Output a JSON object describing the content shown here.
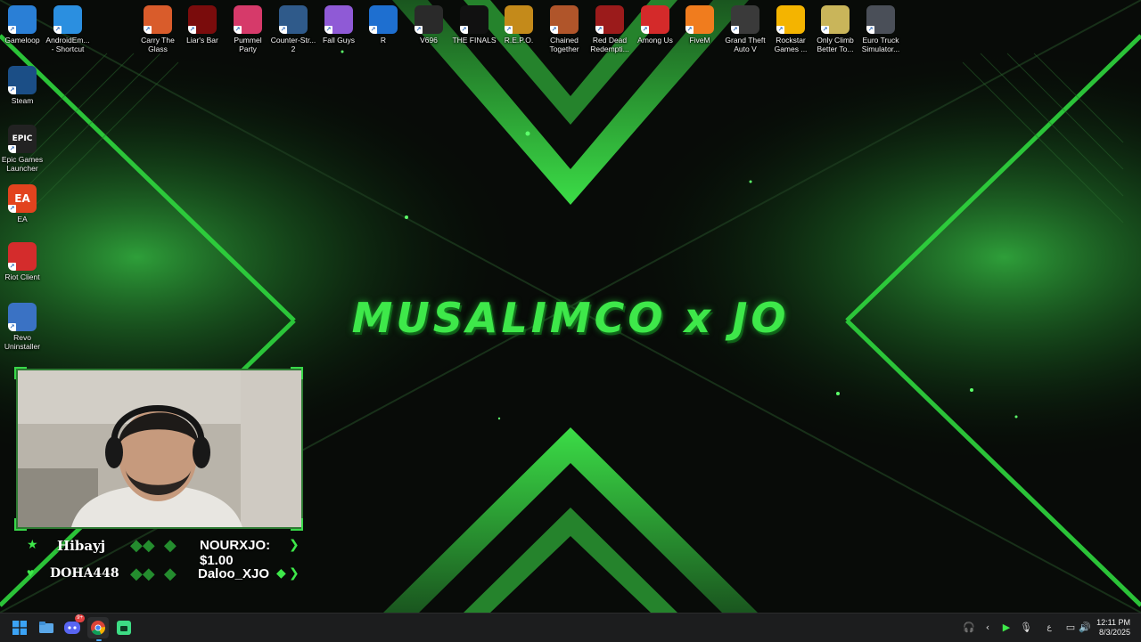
{
  "wallpaper": {
    "title": "MUSALIMCO x JO",
    "accent_color": "#3ee84a"
  },
  "desktop_icons_top": [
    {
      "label": "Gameloop",
      "icon": "gameloop-icon",
      "color": "#2a7fd6"
    },
    {
      "label": "AndroidEm... - Shortcut",
      "icon": "android-emulator-icon",
      "color": "#2b8fe0"
    },
    {
      "label": "Carry The Glass",
      "icon": "carry-the-glass-icon",
      "color": "#d95c2b"
    },
    {
      "label": "Liar's Bar",
      "icon": "liars-bar-icon",
      "color": "#7a0c0c"
    },
    {
      "label": "Pummel Party",
      "icon": "pummel-party-icon",
      "color": "#d63a6a"
    },
    {
      "label": "Counter-Str... 2",
      "icon": "counter-strike-icon",
      "color": "#2f5a8a"
    },
    {
      "label": "Fall Guys",
      "icon": "fall-guys-icon",
      "color": "#8f5ad6"
    },
    {
      "label": "R",
      "icon": "rocket-league-icon",
      "color": "#1e6fd0"
    },
    {
      "label": "V696",
      "icon": "v696-icon",
      "color": "#2a2a2a"
    },
    {
      "label": "THE FINALS",
      "icon": "the-finals-icon",
      "color": "#111111"
    },
    {
      "label": "R.E.P.O.",
      "icon": "repo-icon",
      "color": "#c48a1a"
    },
    {
      "label": "Chained Together",
      "icon": "chained-together-icon",
      "color": "#b0552a"
    },
    {
      "label": "Red Dead Redempti...",
      "icon": "red-dead-icon",
      "color": "#9b1b1b"
    },
    {
      "label": "Among Us",
      "icon": "among-us-icon",
      "color": "#d42a2a"
    },
    {
      "label": "FiveM",
      "icon": "fivem-icon",
      "color": "#f07c1e"
    },
    {
      "label": "Grand Theft Auto V",
      "icon": "gta-v-icon",
      "color": "#3a3a3a"
    },
    {
      "label": "Rockstar Games ...",
      "icon": "rockstar-games-icon",
      "color": "#f4b400"
    },
    {
      "label": "Only Climb Better To...",
      "icon": "only-climb-icon",
      "color": "#c9b55a"
    },
    {
      "label": "Euro Truck Simulator...",
      "icon": "euro-truck-icon",
      "color": "#4a4f58"
    }
  ],
  "desktop_icons_left": [
    {
      "label": "Steam",
      "icon": "steam-icon",
      "color": "#1b4e86"
    },
    {
      "label": "Epic Games Launcher",
      "icon": "epic-games-icon",
      "color": "#222222",
      "glyph": "EPIC"
    },
    {
      "label": "EA",
      "icon": "ea-icon",
      "color": "#e2431e",
      "glyph": "EA"
    },
    {
      "label": "Riot Client",
      "icon": "riot-client-icon",
      "color": "#d42c2c"
    },
    {
      "label": "Revo Uninstaller",
      "icon": "revo-uninstaller-icon",
      "color": "#3a72c4"
    }
  ],
  "overlay": {
    "alert_top_left": "Hibayj",
    "alert_top_right": "NOURXJO: $1.00",
    "alert_bottom_left": "DOHA448",
    "alert_bottom_right": "Daloo_XJO"
  },
  "taskbar": {
    "apps": [
      {
        "name": "start-button",
        "icon": "windows-icon"
      },
      {
        "name": "file-explorer",
        "icon": "folder-icon"
      },
      {
        "name": "discord",
        "icon": "discord-icon",
        "badge": "9+"
      },
      {
        "name": "chrome",
        "icon": "chrome-icon"
      },
      {
        "name": "app-launcher",
        "icon": "android-icon"
      }
    ],
    "tray_lang": "ع",
    "clock_time": "12:11 PM",
    "clock_date": "8/3/2025"
  }
}
